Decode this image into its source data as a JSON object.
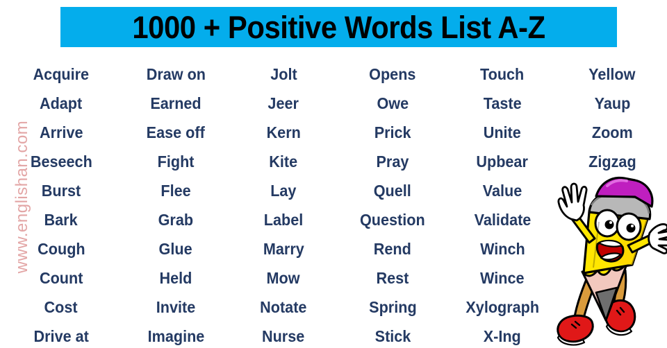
{
  "title": {
    "text": "1000 + Positive Words List A-Z",
    "background_color": "#04ADEC",
    "text_color": "#000000"
  },
  "watermark": {
    "text": "www.englishan.com",
    "color": "#e3a6a6"
  },
  "word_text_color": "#243a63",
  "columns": [
    {
      "name": "column-1",
      "words": [
        "Acquire",
        "Adapt",
        "Arrive",
        "Beseech",
        "Burst",
        "Bark",
        "Cough",
        "Count",
        "Cost",
        "Drive at"
      ]
    },
    {
      "name": "column-2",
      "words": [
        "Draw on",
        "Earned",
        "Ease off",
        "Fight",
        "Flee",
        "Grab",
        "Glue",
        "Held",
        "Invite",
        "Imagine"
      ]
    },
    {
      "name": "column-3",
      "words": [
        "Jolt",
        "Jeer",
        "Kern",
        "Kite",
        "Lay",
        "Label",
        "Marry",
        "Mow",
        "Notate",
        "Nurse"
      ]
    },
    {
      "name": "column-4",
      "words": [
        "Opens",
        "Owe",
        "Prick",
        "Pray",
        "Quell",
        "Question",
        "Rend",
        "Rest",
        "Spring",
        "Stick"
      ]
    },
    {
      "name": "column-5",
      "words": [
        "Touch",
        "Taste",
        "Unite",
        "Upbear",
        "Value",
        "Validate",
        "Winch",
        "Wince",
        "Xylograph",
        "X-Ing"
      ]
    },
    {
      "name": "column-6",
      "words": [
        "Yellow",
        "Yaup",
        "Zoom",
        "Zigzag"
      ]
    }
  ],
  "mascot": {
    "name": "pencil-character",
    "body_color": "#FFE600",
    "eraser_color": "#BF1FBF",
    "ferrule_color": "#B8B8B8",
    "shoe_color": "#E01818",
    "wood_color": "#F2C8BE",
    "graphite_color": "#6E6E6E",
    "mouth_color": "#C00000"
  }
}
